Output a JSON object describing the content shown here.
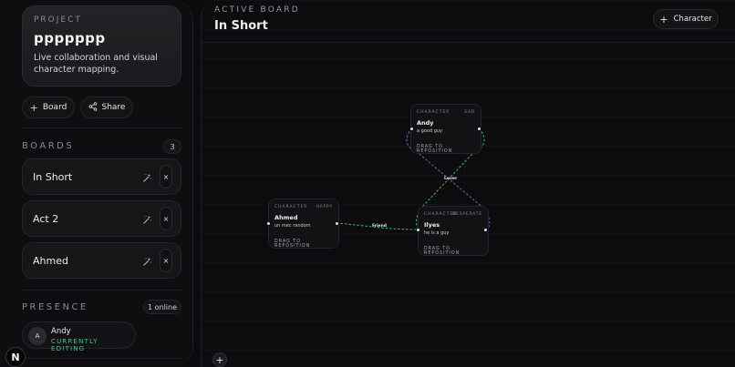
{
  "project": {
    "eyebrow": "PROJECT",
    "title": "ppppppp",
    "description": "Live collaboration and visual character mapping."
  },
  "actions": {
    "board_label": "Board",
    "share_label": "Share"
  },
  "boards": {
    "label": "BOARDS",
    "count": "3",
    "items": [
      {
        "name": "In Short",
        "close": "×"
      },
      {
        "name": "Act 2",
        "close": "×"
      },
      {
        "name": "Ahmed",
        "close": "×"
      }
    ]
  },
  "presence": {
    "label": "PRESENCE",
    "online": "1 online",
    "users": [
      {
        "initial": "A",
        "name": "Andy",
        "status": "CURRENTLY EDITING"
      }
    ]
  },
  "logo": "N",
  "header": {
    "eyebrow": "ACTIVE BOARD",
    "title": "In Short",
    "character_button": "Character"
  },
  "nodes": {
    "andy": {
      "type": "CHARACTER",
      "mood": "SAD",
      "name": "Andy",
      "description": "a good guy",
      "drag": "DRAG TO REPOSITION"
    },
    "ahmed": {
      "type": "CHARACTER",
      "mood": "HAPPY",
      "name": "Ahmed",
      "description": "un mec random",
      "drag": "DRAG TO REPOSITION"
    },
    "ilyes": {
      "type": "CHARACTER",
      "mood": "DESPERATE",
      "name": "Ilyes",
      "description": "he is a guy",
      "drag": "DRAG TO REPOSITION"
    }
  },
  "edges": {
    "friend": "Friend",
    "lover": "Lover"
  },
  "colors": {
    "friend_edge": "#3fbf5e",
    "lover_edge": "#9b4fd6",
    "presence_status": "#4ec38a"
  },
  "icons": {
    "add": "plus-icon",
    "share": "share-icon",
    "wand": "magic-wand-icon",
    "close": "close-icon"
  }
}
